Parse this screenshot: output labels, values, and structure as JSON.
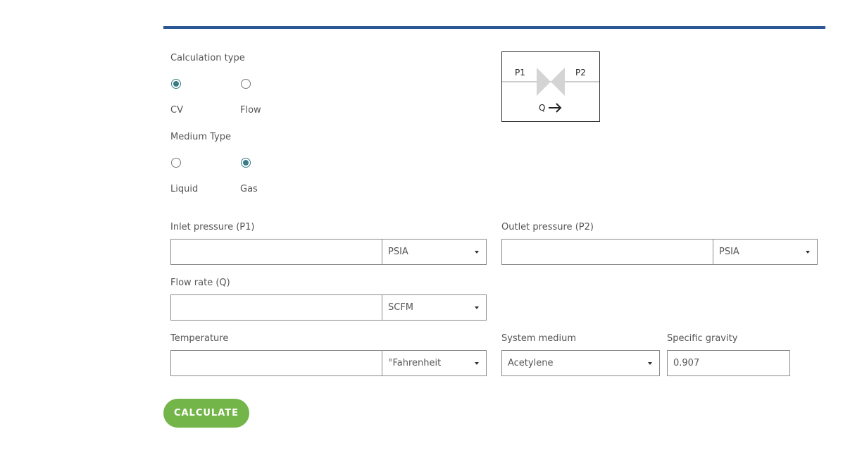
{
  "calculation_type": {
    "label": "Calculation type",
    "options": [
      {
        "label": "CV",
        "selected": true
      },
      {
        "label": "Flow",
        "selected": false
      }
    ]
  },
  "medium_type": {
    "label": "Medium Type",
    "options": [
      {
        "label": "Liquid",
        "selected": false
      },
      {
        "label": "Gas",
        "selected": true
      }
    ]
  },
  "diagram": {
    "p1": "P1",
    "p2": "P2",
    "q": "Q"
  },
  "fields": {
    "inlet_pressure": {
      "label": "Inlet pressure (P1)",
      "value": "",
      "unit": "PSIA"
    },
    "outlet_pressure": {
      "label": "Outlet pressure (P2)",
      "value": "",
      "unit": "PSIA"
    },
    "flow_rate": {
      "label": "Flow rate (Q)",
      "value": "",
      "unit": "SCFM"
    },
    "temperature": {
      "label": "Temperature",
      "value": "",
      "unit": "°Fahrenheit"
    },
    "system_medium": {
      "label": "System medium",
      "value": "Acetylene"
    },
    "specific_gravity": {
      "label": "Specific gravity",
      "value": "0.907"
    }
  },
  "calculate_label": "CALCULATE",
  "colors": {
    "accent_rule": "#2b5797",
    "radio_checked": "#3a7c86",
    "button": "#74b54a",
    "valve": "#d4d4d4"
  }
}
